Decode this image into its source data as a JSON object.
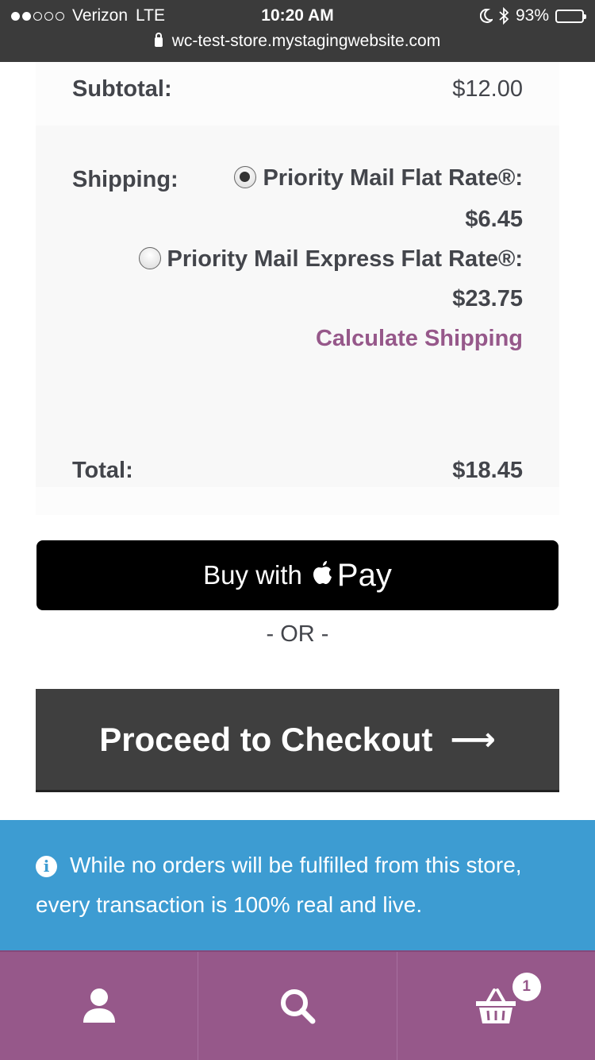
{
  "status_bar": {
    "carrier": "Verizon",
    "network": "LTE",
    "time": "10:20 AM",
    "battery": "93%",
    "url": "wc-test-store.mystagingwebsite.com"
  },
  "cart_totals": {
    "subtotal_label": "Subtotal:",
    "subtotal_value": "$12.00",
    "shipping_label": "Shipping:",
    "shipping_options": [
      {
        "label": "Priority Mail Flat Rate®:",
        "price": "$6.45",
        "selected": true
      },
      {
        "label": "Priority Mail Express Flat Rate®:",
        "price": "$23.75",
        "selected": false
      }
    ],
    "calculate_shipping": "Calculate Shipping",
    "total_label": "Total:",
    "total_value": "$18.45"
  },
  "apple_pay": {
    "prefix": "Buy with",
    "pay": "Pay"
  },
  "separator": "- OR -",
  "checkout": {
    "label": "Proceed to Checkout",
    "arrow": "⟶"
  },
  "notice": {
    "icon": "info-icon",
    "text": "While no orders will be fulfilled from this store, every transaction is 100% real and live."
  },
  "bottom_nav": {
    "items": [
      "account-icon",
      "search-icon",
      "cart-icon"
    ],
    "cart_count": "1"
  },
  "colors": {
    "accent": "#96588a",
    "notice": "#3d9cd2",
    "checkout": "#3f3f3f"
  }
}
